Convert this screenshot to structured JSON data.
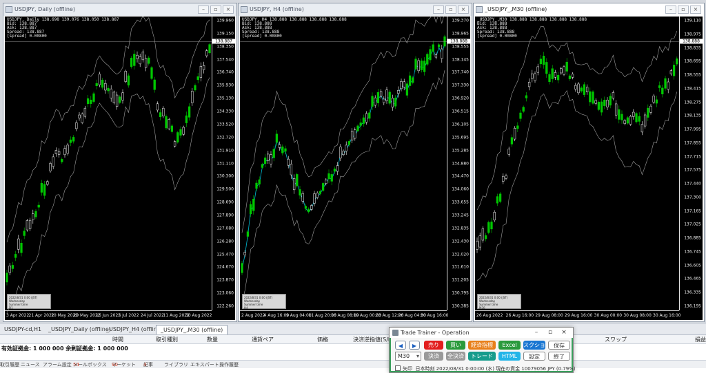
{
  "charts": [
    {
      "title": "USDJPY, Daily (offline)",
      "ohlc": "USDJPY, Daily  138.698 139.076 138.050 138.887",
      "info": [
        "Bid: 138.887",
        "Ask: 138.887",
        "Spread: 138.887",
        "[spread] 0.00800"
      ],
      "prices": [
        "139.960",
        "139.150",
        "138.350",
        "137.540",
        "136.740",
        "135.930",
        "135.130",
        "134.330",
        "133.520",
        "132.720",
        "131.910",
        "131.110",
        "130.300",
        "129.500",
        "128.690",
        "127.890",
        "127.080",
        "126.280",
        "125.470",
        "124.670",
        "123.870",
        "123.060",
        "122.260"
      ],
      "current_price": "138.887",
      "times": [
        "3 Apr 2022",
        "21 Apr 2022",
        "10 May 2022",
        "29 May 2022",
        "16 Jun 2022",
        "5 Jul 2022",
        "24 Jul 2022",
        "11 Aug 2022",
        "30 Aug 2022"
      ],
      "mini": [
        "2022/8/31 0:00 (JST)",
        "Wednesday",
        "Summer time",
        "D1"
      ]
    },
    {
      "title": "USDJPY, H4 (offline)",
      "ohlc": "USDJPY, H4  138.888 138.888 138.888 138.888",
      "info": [
        "Bid: 138.888",
        "Ask: 138.888",
        "Spread: 138.888",
        "[spread] 0.00800"
      ],
      "prices": [
        "139.370",
        "138.965",
        "138.555",
        "138.145",
        "137.740",
        "137.330",
        "136.920",
        "136.515",
        "136.105",
        "135.695",
        "135.285",
        "134.880",
        "134.470",
        "134.060",
        "133.655",
        "133.245",
        "132.835",
        "132.430",
        "132.020",
        "131.610",
        "131.205",
        "130.795",
        "130.385"
      ],
      "current_price": "138.888",
      "times": [
        "2 Aug 2022",
        "4 Aug 16:00",
        "9 Aug 04:00",
        "11 Aug 20:00",
        "16 Aug 08:00",
        "19 Aug 00:00",
        "23 Aug 12:00",
        "26 Aug 04:00",
        "30 Aug 16:00"
      ],
      "mini": [
        "2022/8/31 0:00 (JST)",
        "Wednesday",
        "Summer time",
        "H4"
      ]
    },
    {
      "title": "_USDJPY_,M30 (offline)",
      "ohlc": "_USDJPY_,M30  138.888 138.888 138.888 138.888",
      "info": [
        "Bid: 138.888",
        "Ask: 138.888",
        "Spread: 138.888",
        "[spread] 0.00800"
      ],
      "prices": [
        "139.110",
        "138.975",
        "138.835",
        "138.695",
        "138.555",
        "138.415",
        "138.275",
        "138.135",
        "137.995",
        "137.855",
        "137.715",
        "137.575",
        "137.440",
        "137.300",
        "137.165",
        "137.025",
        "136.885",
        "136.745",
        "136.605",
        "136.465",
        "136.335",
        "136.195"
      ],
      "current_price": "138.888",
      "times": [
        "26 Aug 2022",
        "26 Aug 16:00",
        "29 Aug 08:00",
        "29 Aug 16:00",
        "30 Aug 00:00",
        "30 Aug 08:00",
        "30 Aug 16:00"
      ],
      "mini": [
        "2022/8/31 0:00 (JST)",
        "Wednesday",
        "Summer time",
        "M30"
      ]
    }
  ],
  "tabs": [
    "USDJPY-cd,H1",
    "_USDJPY_Daily (offline)",
    "_USDJPY_H4 (offline)",
    "_USDJPY_,M30 (offline)"
  ],
  "terminal": {
    "headers": [
      "時間",
      "取引種別",
      "数量",
      "通貨ペア",
      "価格",
      "決済逆指値(S/L)",
      "スワップ",
      "損益"
    ],
    "balance": "有効証拠金: 1 000 000  余剰証拠金: 1 000 000"
  },
  "bottom_tabs": [
    {
      "label": "取引履歴",
      "count": ""
    },
    {
      "label": "ニュース",
      "count": ""
    },
    {
      "label": "アラーム設定",
      "count": ""
    },
    {
      "label": "メールボックス",
      "count": "54"
    },
    {
      "label": "マーケット",
      "count": "90"
    },
    {
      "label": "記事",
      "count": "4"
    },
    {
      "label": "ライブラリ",
      "count": ""
    },
    {
      "label": "エキスパート",
      "count": ""
    },
    {
      "label": "操作履歴",
      "count": ""
    }
  ],
  "dialog": {
    "title": "Trade Trainer - Operation",
    "prev": "◀",
    "next": "▶",
    "sell": "売り",
    "buy": "買い",
    "indicators": "経済指標",
    "excel": "Excel",
    "screenshot": "スクショ",
    "save": "保存",
    "timeframe": "M30",
    "settle": "決済",
    "settle_all": "全決済",
    "trade": "トレード",
    "html": "HTML",
    "settings": "設定",
    "exit": "終了",
    "arrow_label": "矢印",
    "status": "日本時刻 2022/08/31 0:00:00 (水)  現在の資金 10079056 JPY (0.79%)"
  },
  "colors": {
    "bull": "#00c800",
    "bear": "#ffffff",
    "band": "#a0a0a0",
    "ma": "#00bcd4"
  }
}
